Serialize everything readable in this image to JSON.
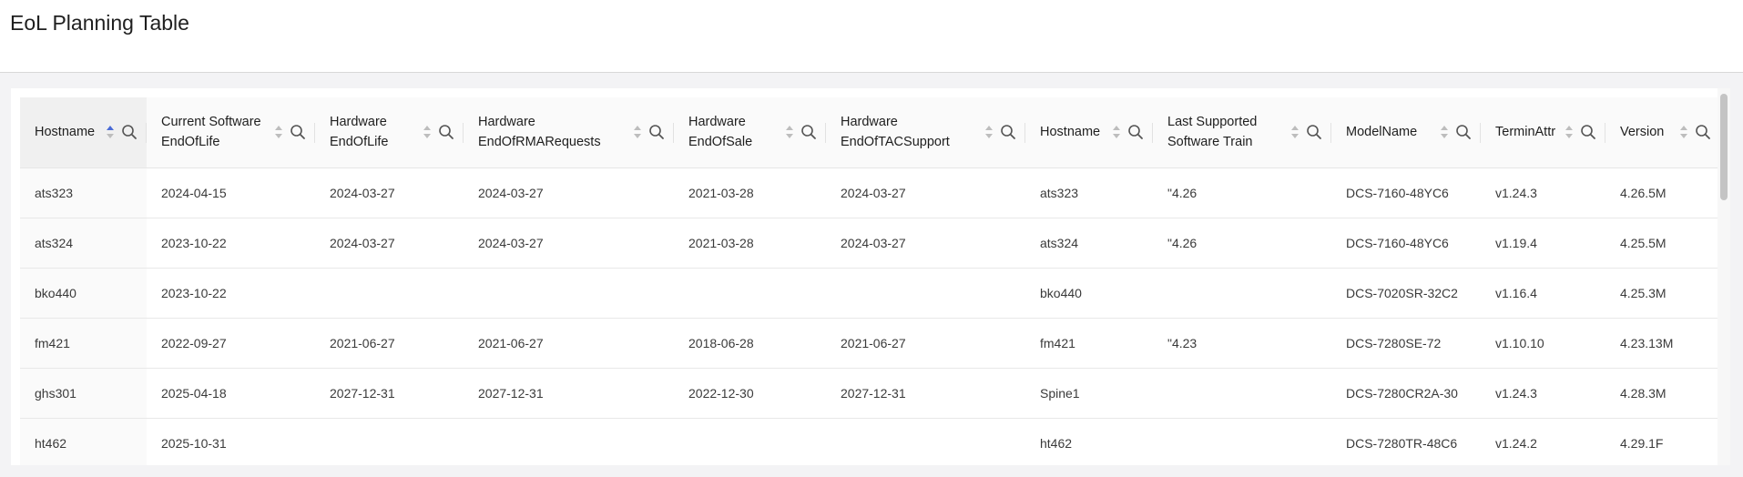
{
  "page": {
    "title": "EoL Planning Table"
  },
  "columns": [
    {
      "label": "Hostname",
      "sort": "asc"
    },
    {
      "label": "Current Software EndOfLife",
      "sort": "none"
    },
    {
      "label": "Hardware EndOfLife",
      "sort": "none"
    },
    {
      "label": "Hardware EndOfRMARequests",
      "sort": "none"
    },
    {
      "label": "Hardware EndOfSale",
      "sort": "none"
    },
    {
      "label": "Hardware EndOfTACSupport",
      "sort": "none"
    },
    {
      "label": "Hostname",
      "sort": "none"
    },
    {
      "label": "Last Supported Software Train",
      "sort": "none"
    },
    {
      "label": "ModelName",
      "sort": "none"
    },
    {
      "label": "TerminAttr",
      "sort": "none"
    },
    {
      "label": "Version",
      "sort": "none"
    }
  ],
  "rows": [
    [
      "ats323",
      "2024-04-15",
      "2024-03-27",
      "2024-03-27",
      "2021-03-28",
      "2024-03-27",
      "ats323",
      "\"4.26",
      "DCS-7160-48YC6",
      "v1.24.3",
      "4.26.5M"
    ],
    [
      "ats324",
      "2023-10-22",
      "2024-03-27",
      "2024-03-27",
      "2021-03-28",
      "2024-03-27",
      "ats324",
      "\"4.26",
      "DCS-7160-48YC6",
      "v1.19.4",
      "4.25.5M"
    ],
    [
      "bko440",
      "2023-10-22",
      "",
      "",
      "",
      "",
      "bko440",
      "",
      "DCS-7020SR-32C2",
      "v1.16.4",
      "4.25.3M"
    ],
    [
      "fm421",
      "2022-09-27",
      "2021-06-27",
      "2021-06-27",
      "2018-06-28",
      "2021-06-27",
      "fm421",
      "\"4.23",
      "DCS-7280SE-72",
      "v1.10.10",
      "4.23.13M"
    ],
    [
      "ghs301",
      "2025-04-18",
      "2027-12-31",
      "2027-12-31",
      "2022-12-30",
      "2027-12-31",
      "Spine1",
      "",
      "DCS-7280CR2A-30",
      "v1.24.3",
      "4.28.3M"
    ],
    [
      "ht462",
      "2025-10-31",
      "",
      "",
      "",
      "",
      "ht462",
      "",
      "DCS-7280TR-48C6",
      "v1.24.2",
      "4.29.1F"
    ]
  ],
  "icons": {
    "search": "search-icon",
    "sort": "sort-arrows-icon"
  },
  "colors": {
    "accent": "#4a6bd6",
    "header_bg": "#fafafa",
    "page_bg": "#f3f3f5"
  }
}
